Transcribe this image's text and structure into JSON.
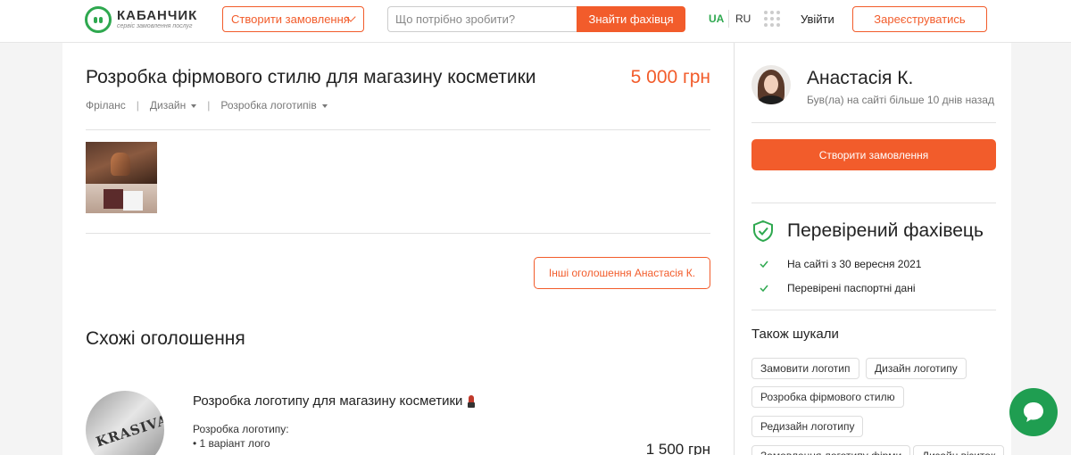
{
  "header": {
    "logo_name": "КАБАНЧИК",
    "logo_tagline": "сервіс замовлення послуг",
    "create_order_label": "Створити замовлення",
    "search_placeholder": "Що потрібно зробити?",
    "search_button_label": "Знайти фахівця",
    "lang_ua": "UA",
    "lang_ru": "RU",
    "login_label": "Увійти",
    "register_label": "Зареєструватись"
  },
  "listing": {
    "title": "Розробка фірмового стилю для магазину косметики",
    "price": "5 000 грн",
    "breadcrumb": [
      "Фріланс",
      "Дизайн",
      "Розробка логотипів"
    ],
    "other_ads_label": "Інші оголошення Анастасія К."
  },
  "similar": {
    "title": "Схожі оголошення",
    "items": [
      {
        "avatar_text": "KRASIVA",
        "title": "Розробка логотипу для магазину косметики",
        "icon": "lipstick-icon",
        "desc_line1": "Розробка логотипу:",
        "desc_line2": "• 1 варіант лого",
        "price": "1 500 грн"
      }
    ]
  },
  "sidebar": {
    "user_name": "Анастасія К.",
    "user_seen": "Був(ла) на сайті більше 10 днів назад",
    "create_order_label": "Створити замовлення",
    "verified_title": "Перевірений фахівець",
    "checks": [
      "На сайті з 30 вересня 2021",
      "Перевірені паспортні дані"
    ],
    "also_title": "Також шукали",
    "tags": [
      "Замовити логотип",
      "Дизайн логотипу",
      "Розробка фірмового стилю",
      "Редизайн логотипу",
      "Замовлення логотипу фірми",
      "Дизайн візиток"
    ]
  },
  "colors": {
    "accent": "#f25c2b",
    "brand_green": "#2ea84f",
    "chat_green": "#1f9e51"
  }
}
